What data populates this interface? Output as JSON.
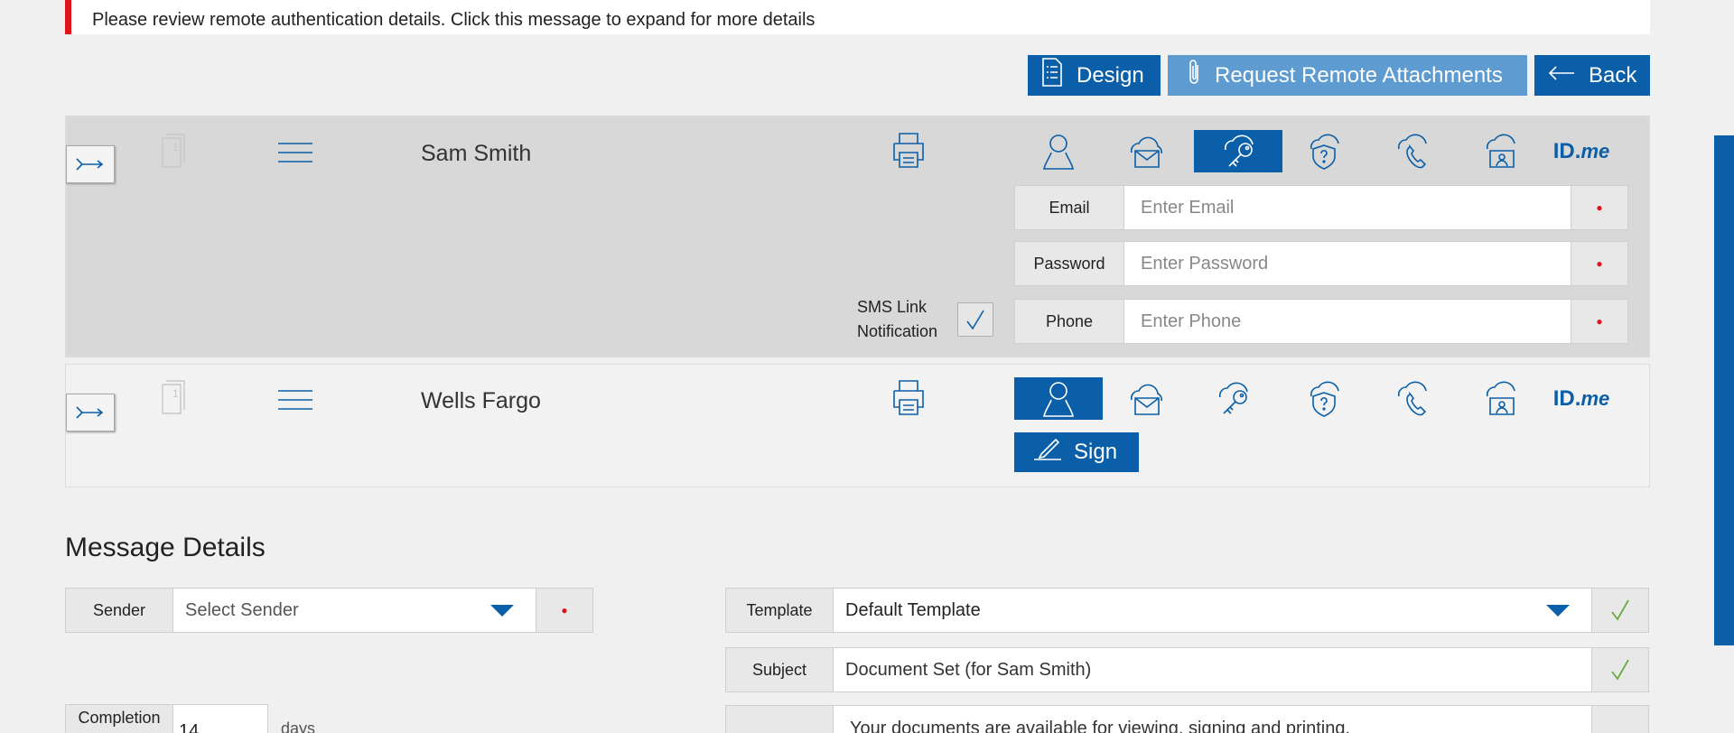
{
  "alert": {
    "text": "Please review remote authentication details. Click this message to expand for more details"
  },
  "toolbar": {
    "design": "Design",
    "request": "Request Remote Attachments",
    "back": "Back"
  },
  "recipients": [
    {
      "name": "Sam Smith",
      "doc_count": "1"
    },
    {
      "name": "Wells Fargo",
      "doc_count": "1"
    }
  ],
  "auth": {
    "email_label": "Email",
    "email_placeholder": "Enter Email",
    "password_label": "Password",
    "password_placeholder": "Enter Password",
    "phone_label": "Phone",
    "phone_placeholder": "Enter Phone",
    "sms_line1": "SMS Link",
    "sms_line2": "Notification",
    "idme_id": "ID.",
    "idme_me": "me"
  },
  "sign_label": "Sign",
  "message": {
    "heading": "Message Details",
    "sender_label": "Sender",
    "sender_value": "Select Sender",
    "template_label": "Template",
    "template_value": "Default Template",
    "subject_label": "Subject",
    "subject_value": "Document Set (for Sam Smith)",
    "completion_label": "Completion",
    "completion_value": "14",
    "completion_unit": "days",
    "body_preview": "Your documents are available for viewing, signing and printing."
  },
  "colors": {
    "accent": "#0a5fa8",
    "accent_light": "#5e9bd0",
    "alert": "#e0151c",
    "check": "#6aab3a"
  }
}
